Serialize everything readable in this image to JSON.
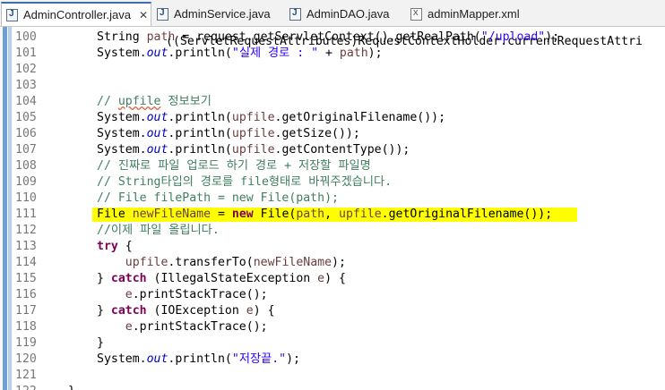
{
  "tabs": [
    {
      "label": "AdminController.java",
      "icon": "java-file-icon",
      "close": "✕",
      "active": true
    },
    {
      "label": "AdminService.java",
      "icon": "java-file-icon",
      "active": false
    },
    {
      "label": "AdminDAO.java",
      "icon": "java-file-icon",
      "active": false
    },
    {
      "label": "adminMapper.xml",
      "icon": "xml-file-icon",
      "active": false
    }
  ],
  "top_partial_line": "((ServletRequestAttributes)RequestContextHolder.currentRequestAttri",
  "highlighted_line": "111",
  "colors": {
    "keyword": "#7f0055",
    "string": "#2a00ff",
    "comment": "#3f7f5f",
    "field": "#0000c0",
    "highlight": "#ffff00"
  },
  "lines": [
    {
      "no": "100",
      "code": [
        [
          "p",
          "String "
        ],
        [
          "lv",
          "path"
        ],
        [
          "p",
          " = request.getServletContext().getRealPath("
        ],
        [
          "str",
          "\"/upload\""
        ],
        [
          "p",
          ");"
        ]
      ]
    },
    {
      "no": "101",
      "code": [
        [
          "p",
          "System."
        ],
        [
          "fld",
          "out"
        ],
        [
          "p",
          ".println("
        ],
        [
          "str",
          "\"실제 경로 : \""
        ],
        [
          "p",
          " + "
        ],
        [
          "lv",
          "path"
        ],
        [
          "p",
          ");"
        ]
      ]
    },
    {
      "no": "102",
      "code": []
    },
    {
      "no": "103",
      "code": []
    },
    {
      "no": "104",
      "code": [
        [
          "cm",
          "// "
        ],
        [
          "cmw",
          "upfile"
        ],
        [
          "cm",
          " 정보보기"
        ]
      ]
    },
    {
      "no": "105",
      "code": [
        [
          "p",
          "System."
        ],
        [
          "fld",
          "out"
        ],
        [
          "p",
          ".println("
        ],
        [
          "lv",
          "upfile"
        ],
        [
          "p",
          ".getOriginalFilename());"
        ]
      ]
    },
    {
      "no": "106",
      "code": [
        [
          "p",
          "System."
        ],
        [
          "fld",
          "out"
        ],
        [
          "p",
          ".println("
        ],
        [
          "lv",
          "upfile"
        ],
        [
          "p",
          ".getSize());"
        ]
      ]
    },
    {
      "no": "107",
      "code": [
        [
          "p",
          "System."
        ],
        [
          "fld",
          "out"
        ],
        [
          "p",
          ".println("
        ],
        [
          "lv",
          "upfile"
        ],
        [
          "p",
          ".getContentType());"
        ]
      ]
    },
    {
      "no": "108",
      "code": [
        [
          "cm",
          "// 진짜로 파일 업로드 하기 경로 + 저장할 파일명"
        ]
      ]
    },
    {
      "no": "109",
      "code": [
        [
          "cm",
          "// String타입의 경로를 file형태로 바꿔주겠습니다."
        ]
      ]
    },
    {
      "no": "110",
      "code": [
        [
          "cm",
          "// File filePath = new File(path);"
        ]
      ]
    },
    {
      "no": "111",
      "code": [
        [
          "p",
          "File "
        ],
        [
          "lv",
          "newFileName"
        ],
        [
          "p",
          " = "
        ],
        [
          "kw",
          "new"
        ],
        [
          "p",
          " File("
        ],
        [
          "lv",
          "path"
        ],
        [
          "p",
          ", "
        ],
        [
          "lv",
          "upfile"
        ],
        [
          "p",
          ".getOriginalFilename());"
        ]
      ]
    },
    {
      "no": "112",
      "code": [
        [
          "cm",
          "//이제 파일 올립니다."
        ]
      ]
    },
    {
      "no": "113",
      "code": [
        [
          "kw",
          "try"
        ],
        [
          "p",
          " {"
        ]
      ]
    },
    {
      "no": "114",
      "code": [
        [
          "p",
          "    "
        ],
        [
          "lv",
          "upfile"
        ],
        [
          "p",
          ".transferTo("
        ],
        [
          "lv",
          "newFileName"
        ],
        [
          "p",
          ");"
        ]
      ]
    },
    {
      "no": "115",
      "code": [
        [
          "p",
          "} "
        ],
        [
          "kw",
          "catch"
        ],
        [
          "p",
          " (IllegalStateException "
        ],
        [
          "lv",
          "e"
        ],
        [
          "p",
          ") {"
        ]
      ]
    },
    {
      "no": "116",
      "code": [
        [
          "p",
          "    "
        ],
        [
          "lv",
          "e"
        ],
        [
          "p",
          ".printStackTrace();"
        ]
      ]
    },
    {
      "no": "117",
      "code": [
        [
          "p",
          "} "
        ],
        [
          "kw",
          "catch"
        ],
        [
          "p",
          " (IOException "
        ],
        [
          "lv",
          "e"
        ],
        [
          "p",
          ") {"
        ]
      ]
    },
    {
      "no": "118",
      "code": [
        [
          "p",
          "    "
        ],
        [
          "lv",
          "e"
        ],
        [
          "p",
          ".printStackTrace();"
        ]
      ]
    },
    {
      "no": "119",
      "code": [
        [
          "p",
          "}"
        ]
      ]
    },
    {
      "no": "120",
      "code": [
        [
          "p",
          "System."
        ],
        [
          "fld",
          "out"
        ],
        [
          "p",
          ".println("
        ],
        [
          "str",
          "\"저장끝.\""
        ],
        [
          "p",
          ");"
        ]
      ]
    },
    {
      "no": "121",
      "code": []
    },
    {
      "no": "122",
      "code": [
        [
          "p",
          "}"
        ]
      ]
    }
  ]
}
